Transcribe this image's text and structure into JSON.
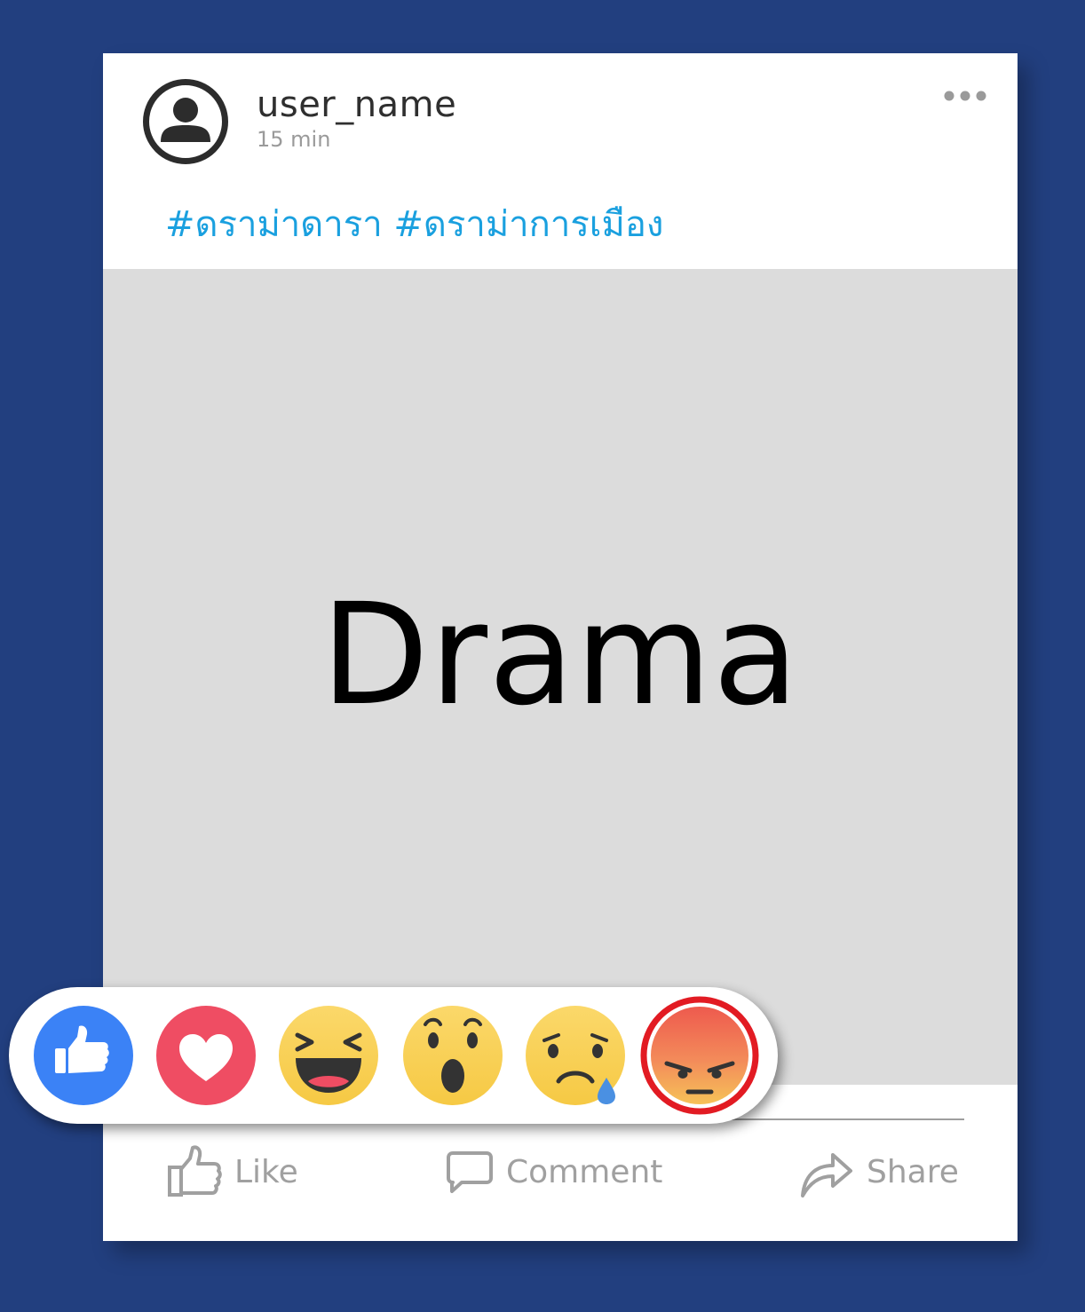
{
  "post": {
    "user_name": "user_name",
    "time": "15 min",
    "hashtags": [
      "#ดราม่าดารา",
      "#ดราม่าการเมือง"
    ],
    "image_text": "Drama"
  },
  "actions": {
    "like": "Like",
    "comment": "Comment",
    "share": "Share"
  },
  "reactions": [
    "like",
    "love",
    "haha",
    "wow",
    "sad",
    "angry"
  ],
  "highlighted_reaction": "angry",
  "colors": {
    "background": "#223f7f",
    "hashtag": "#1aa0df",
    "like_blue": "#3b82f6",
    "love_red": "#ef4d63",
    "highlight_ring": "#e21b23"
  },
  "icons": {
    "avatar": "user-avatar-icon",
    "more": "more-dots-icon",
    "like": "thumbs-up-outline-icon",
    "comment": "speech-bubble-icon",
    "share": "share-arrow-icon"
  }
}
